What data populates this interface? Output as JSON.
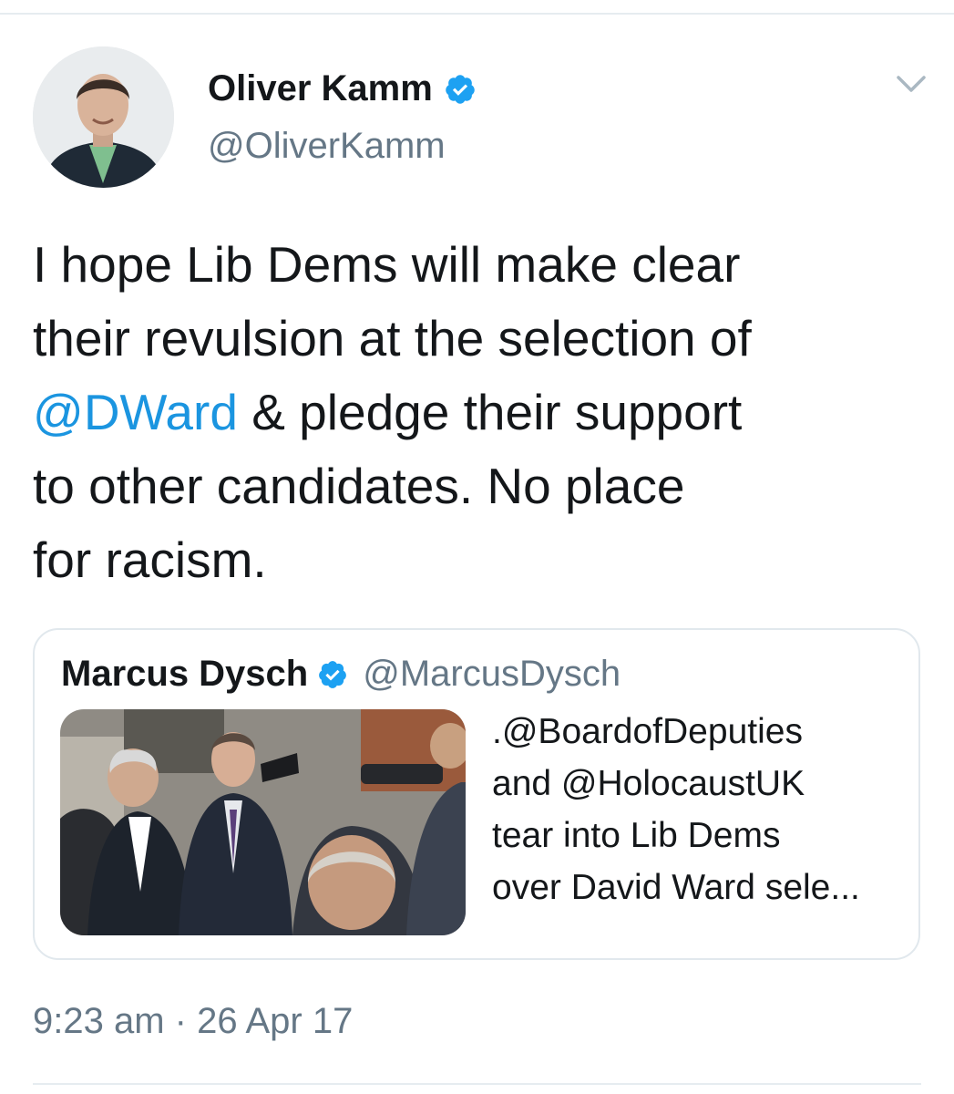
{
  "tweet": {
    "author": {
      "display_name": "Oliver Kamm",
      "handle": "@OliverKamm",
      "verified": true,
      "avatar_icon": "profile-photo"
    },
    "text_lines": [
      [
        {
          "text": "I hope Lib Dems will make clear"
        }
      ],
      [
        {
          "text": "their revulsion at the selection of"
        }
      ],
      [
        {
          "text": "@DWard",
          "mention": true
        },
        {
          "text": " & pledge their support"
        }
      ],
      [
        {
          "text": "to other candidates. No place"
        }
      ],
      [
        {
          "text": "for racism."
        }
      ]
    ],
    "timestamp": "9:23 am · 26 Apr 17",
    "menu_icon": "chevron-down-icon"
  },
  "quote": {
    "display_name": "Marcus Dysch",
    "handle": "@MarcusDysch",
    "verified": true,
    "image_icon": "news-photo",
    "text_lines": [
      ".@BoardofDeputies",
      "and @HolocaustUK",
      "tear into Lib Dems",
      "over David Ward sele..."
    ]
  },
  "colors": {
    "link": "#1b95e0",
    "verified": "#1da1f2",
    "secondary_text": "#657786",
    "border": "#e1e8ed"
  }
}
